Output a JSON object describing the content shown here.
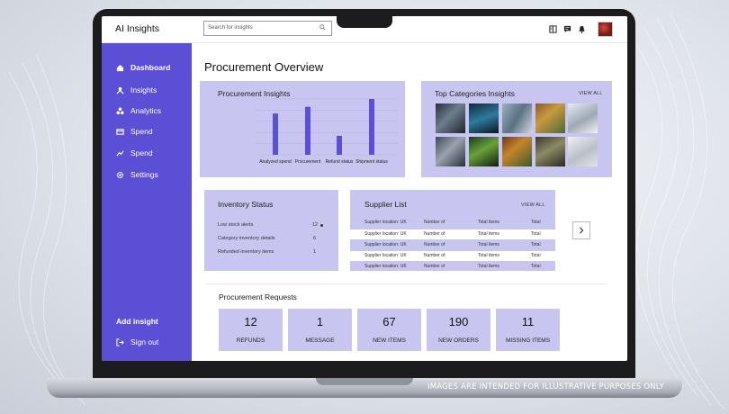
{
  "app": {
    "title": "AI Insights"
  },
  "search": {
    "placeholder": "Search for insights"
  },
  "sidebar": {
    "items": [
      {
        "label": "Dashboard",
        "icon": "home-icon"
      },
      {
        "label": "Insights",
        "icon": "insights-icon"
      },
      {
        "label": "Analytics",
        "icon": "analytics-icon"
      },
      {
        "label": "Spend",
        "icon": "card-icon"
      },
      {
        "label": "Spend",
        "icon": "trend-icon"
      },
      {
        "label": "Settings",
        "icon": "gear-icon"
      }
    ],
    "add_insight": "Add insight",
    "sign_out": "Sign out"
  },
  "main": {
    "page_title": "Procurement Overview"
  },
  "procurement_insights": {
    "title": "Procurement Insights"
  },
  "chart_data": {
    "type": "bar",
    "title": "Procurement Insights",
    "categories": [
      "Analyzed spend",
      "Procurement",
      "Refund status",
      "Shipment status"
    ],
    "values": [
      74,
      86,
      34,
      100
    ],
    "ylim": [
      0,
      100
    ],
    "grid": true
  },
  "top_categories": {
    "title": "Top Categories Insights",
    "view_all": "VIEW ALL"
  },
  "inventory": {
    "title": "Inventory Status",
    "rows": [
      {
        "label": "Low stock alerts",
        "value": "12"
      },
      {
        "label": "Category inventory details",
        "value": "6"
      },
      {
        "label": "Refunded inventory items",
        "value": "1"
      }
    ]
  },
  "suppliers": {
    "title": "Supplier List",
    "view_all": "VIEW ALL",
    "rows": [
      {
        "location": "Supplier location: UK",
        "number": "Number of",
        "items": "Total items",
        "total": "Total"
      },
      {
        "location": "Supplier location: UK",
        "number": "Number of",
        "items": "Total items",
        "total": "Total"
      },
      {
        "location": "Supplier location: UK",
        "number": "Number of",
        "items": "Total items",
        "total": "Total"
      },
      {
        "location": "Supplier location: UK",
        "number": "Number of",
        "items": "Total items",
        "total": "Total"
      },
      {
        "location": "Supplier location: UK",
        "number": "Number of",
        "items": "Total items",
        "total": "Total"
      }
    ]
  },
  "requests": {
    "title": "Procurement Requests",
    "stats": [
      {
        "value": "12",
        "label": "REFUNDS"
      },
      {
        "value": "1",
        "label": "MESSAGE"
      },
      {
        "value": "67",
        "label": "NEW ITEMS"
      },
      {
        "value": "190",
        "label": "NEW ORDERS"
      },
      {
        "value": "11",
        "label": "MISSING ITEMS"
      }
    ]
  },
  "disclaimer": "IMAGES ARE INTENDED FOR ILLUSTRATIVE PURPOSES ONLY",
  "colors": {
    "accent": "#5b4fd6",
    "card": "#c8c6f0",
    "bar": "#5b4fd6"
  }
}
